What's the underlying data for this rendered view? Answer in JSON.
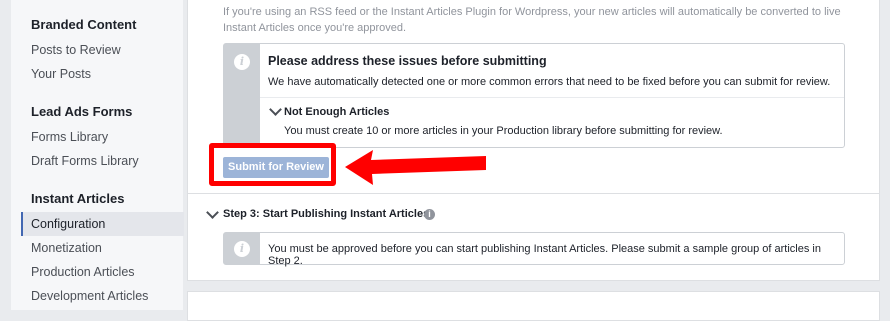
{
  "sidebar": {
    "sections": [
      {
        "title": "Branded Content",
        "items": [
          "Posts to Review",
          "Your Posts"
        ]
      },
      {
        "title": "Lead Ads Forms",
        "items": [
          "Forms Library",
          "Draft Forms Library"
        ]
      },
      {
        "title": "Instant Articles",
        "items": [
          "Configuration",
          "Monetization",
          "Production Articles",
          "Development Articles"
        ]
      }
    ],
    "active_item": "Configuration"
  },
  "step2": {
    "rss_note": "If you're using an RSS feed or the Instant Articles Plugin for Wordpress, your new articles will automatically be converted to live Instant Articles once you're approved.",
    "issues_box": {
      "title": "Please address these issues before submitting",
      "description": "We have automatically detected one or more common errors that need to be fixed before you can submit for review.",
      "issue": {
        "title": "Not Enough Articles",
        "detail": "You must create 10 or more articles in your Production library before submitting for review."
      }
    },
    "submit_label": "Submit for Review"
  },
  "step3": {
    "title": "Step 3: Start Publishing Instant Articles",
    "notice": "You must be approved before you can start publishing Instant Articles. Please submit a sample group of articles in Step 2."
  },
  "colors": {
    "highlight": "#ff0000",
    "button_disabled": "#9cb4d8",
    "accent": "#4267b2"
  },
  "icons": [
    "info-icon",
    "chevron-down-icon",
    "question-icon",
    "arrow-annotation"
  ]
}
